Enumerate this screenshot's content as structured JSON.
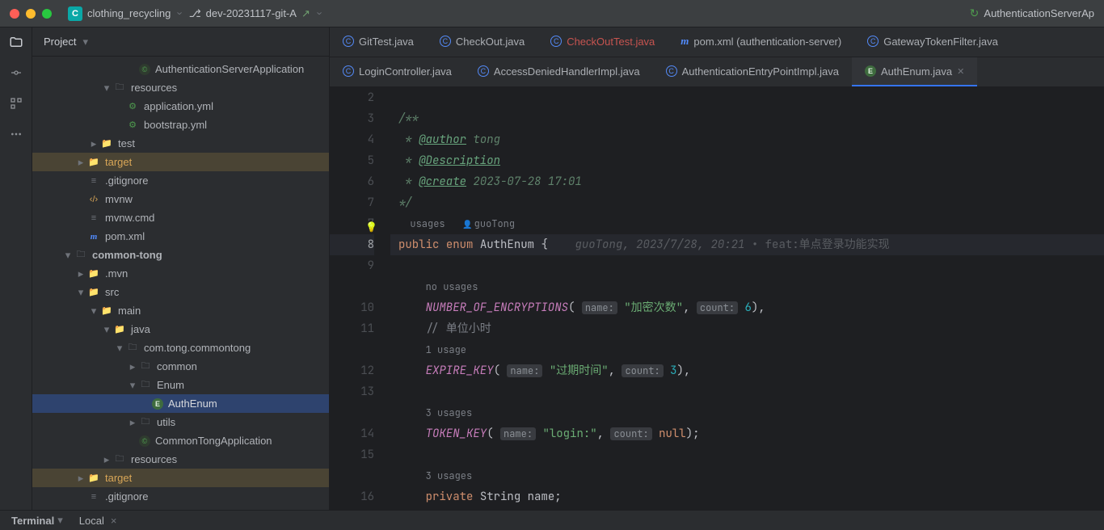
{
  "titlebar": {
    "project": "clothing_recycling",
    "badge": "C",
    "branch": "dev-20231117-git-A",
    "context": "AuthenticationServerAp"
  },
  "sidebar": {
    "header": "Project"
  },
  "tree": [
    {
      "d": 7,
      "a": "",
      "i": "class",
      "t": "AuthenticationServerApplication"
    },
    {
      "d": 5,
      "a": "v",
      "i": "folder-mod",
      "t": "resources"
    },
    {
      "d": 6,
      "a": "",
      "i": "yml",
      "t": "application.yml"
    },
    {
      "d": 6,
      "a": "",
      "i": "yml",
      "t": "bootstrap.yml"
    },
    {
      "d": 4,
      "a": ">",
      "i": "folder",
      "t": "test"
    },
    {
      "d": 3,
      "a": ">",
      "i": "folder-orange",
      "t": "target",
      "hl": true,
      "warn": true
    },
    {
      "d": 3,
      "a": "",
      "i": "file",
      "t": ".gitignore"
    },
    {
      "d": 3,
      "a": "",
      "i": "xml",
      "t": "mvnw"
    },
    {
      "d": 3,
      "a": "",
      "i": "file",
      "t": "mvnw.cmd"
    },
    {
      "d": 3,
      "a": "",
      "i": "m",
      "t": "pom.xml"
    },
    {
      "d": 2,
      "a": "v",
      "i": "folder-mod",
      "t": "common-tong",
      "bold": true
    },
    {
      "d": 3,
      "a": ">",
      "i": "folder",
      "t": ".mvn"
    },
    {
      "d": 3,
      "a": "v",
      "i": "folder",
      "t": "src"
    },
    {
      "d": 4,
      "a": "v",
      "i": "folder",
      "t": "main"
    },
    {
      "d": 5,
      "a": "v",
      "i": "folder-blue",
      "t": "java"
    },
    {
      "d": 6,
      "a": "v",
      "i": "folder-mod",
      "t": "com.tong.commontong"
    },
    {
      "d": 7,
      "a": ">",
      "i": "folder-mod",
      "t": "common"
    },
    {
      "d": 7,
      "a": "v",
      "i": "folder-mod",
      "t": "Enum"
    },
    {
      "d": 8,
      "a": "",
      "i": "enum",
      "t": "AuthEnum",
      "sel": true
    },
    {
      "d": 7,
      "a": ">",
      "i": "folder-mod",
      "t": "utils"
    },
    {
      "d": 7,
      "a": "",
      "i": "class",
      "t": "CommonTongApplication"
    },
    {
      "d": 5,
      "a": ">",
      "i": "folder-mod",
      "t": "resources"
    },
    {
      "d": 3,
      "a": ">",
      "i": "folder-orange",
      "t": "target",
      "hl": true,
      "warn": true
    },
    {
      "d": 3,
      "a": "",
      "i": "file",
      "t": ".gitignore"
    }
  ],
  "tabs_row1": [
    {
      "label": "GitTest.java",
      "icon": "c"
    },
    {
      "label": "CheckOut.java",
      "icon": "c"
    },
    {
      "label": "CheckOutTest.java",
      "icon": "c",
      "dirty": true
    },
    {
      "label": "pom.xml (authentication-server)",
      "icon": "m"
    },
    {
      "label": "GatewayTokenFilter.java",
      "icon": "c"
    }
  ],
  "tabs_row2": [
    {
      "label": "LoginController.java",
      "icon": "c"
    },
    {
      "label": "AccessDeniedHandlerImpl.java",
      "icon": "c"
    },
    {
      "label": "AuthenticationEntryPointImpl.java",
      "icon": "c"
    },
    {
      "label": "AuthEnum.java",
      "icon": "e",
      "active": true,
      "closable": true
    }
  ],
  "editor": {
    "lines": [
      "2",
      "3",
      "4",
      "5",
      "6",
      "7",
      "7",
      "8",
      "9",
      "",
      "10",
      "11",
      "",
      "12",
      "13",
      "",
      "14",
      "15",
      "",
      "16"
    ],
    "doc_open": "/**",
    "doc_author_tag": "@author",
    "doc_author": " tong",
    "doc_desc_tag": "@Description",
    "doc_create_tag": "@create",
    "doc_create": " 2023-07-28 17:01",
    "doc_close": "*/",
    "usage7": "  usages",
    "usage7_icon": "guoTong",
    "public": "public",
    "enum": "enum",
    "classname": "AuthEnum",
    "brace": "{",
    "annot": "guoTong, 2023/7/28, 20:21 ",
    "annot_feat": "• feat:",
    "annot_msg": "单点登录功能实现",
    "no_usages": "no usages",
    "c1": "NUMBER_OF_ENCRYPTIONS",
    "c1_nm": "name:",
    "c1_nmv": "\"加密次数\"",
    "c1_ct": "count:",
    "c1_ctv": "6",
    "comment11": "// 单位小时",
    "one_usage": "1 usage",
    "c2": "EXPIRE_KEY",
    "c2_nm": "name:",
    "c2_nmv": "\"过期时间\"",
    "c2_ct": "count:",
    "c2_ctv": "3",
    "three_usages": "3 usages",
    "c3": "TOKEN_KEY",
    "c3_nm": "name:",
    "c3_nmv": "\"login:\"",
    "c3_ct": "count:",
    "c3_ctv": "null",
    "three_usages2": "3 usages",
    "private": "private",
    "String": "String",
    "name": "name",
    "star": " * "
  },
  "bottom": {
    "terminal": "Terminal",
    "local": "Local"
  }
}
